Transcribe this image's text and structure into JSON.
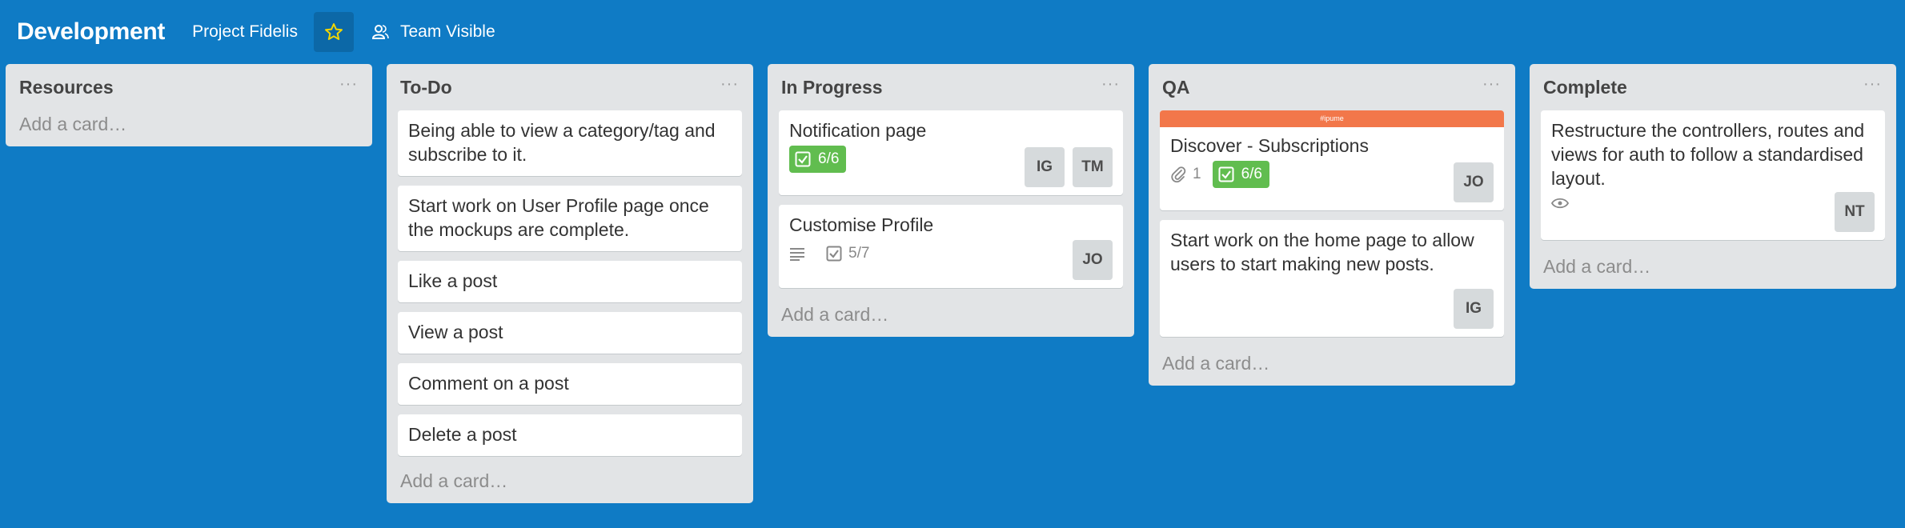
{
  "header": {
    "board_title": "Development",
    "project_link": "Project Fidelis",
    "visibility": "Team Visible",
    "star_color": "#f2d600"
  },
  "colors": {
    "background": "#0f7bc5",
    "list_bg": "#e2e4e6",
    "label_orange": "#f2774a",
    "badge_green": "#61bd4f"
  },
  "list_menu": "···",
  "lists": [
    {
      "title": "Resources",
      "add_card": "Add a card…",
      "cards": []
    },
    {
      "title": "To-Do",
      "add_card": "Add a card…",
      "cards": [
        {
          "title": "Being able to view a category/tag and subscribe to it."
        },
        {
          "title": "Start work on User Profile page once the mockups are complete."
        },
        {
          "title": "Like a post"
        },
        {
          "title": "View a post"
        },
        {
          "title": "Comment on a post"
        },
        {
          "title": "Delete a post"
        }
      ]
    },
    {
      "title": "In Progress",
      "add_card": "Add a card…",
      "cards": [
        {
          "title": "Notification page",
          "checklist": "6/6",
          "members": [
            "IG",
            "TM"
          ]
        },
        {
          "title": "Customise Profile",
          "checklist": "5/7",
          "members": [
            "JO"
          ]
        }
      ]
    },
    {
      "title": "QA",
      "add_card": "Add a card…",
      "cards": [
        {
          "label": "#ipume",
          "title": "Discover - Subscriptions",
          "attachments": "1",
          "checklist": "6/6",
          "members": [
            "JO"
          ]
        },
        {
          "title": "Start work on the home page to allow users to start making new posts.",
          "members": [
            "IG"
          ]
        }
      ]
    },
    {
      "title": "Complete",
      "add_card": "Add a card…",
      "cards": [
        {
          "title": "Restructure the controllers, routes and views for auth to follow a standardised layout.",
          "members": [
            "NT"
          ]
        }
      ]
    }
  ]
}
